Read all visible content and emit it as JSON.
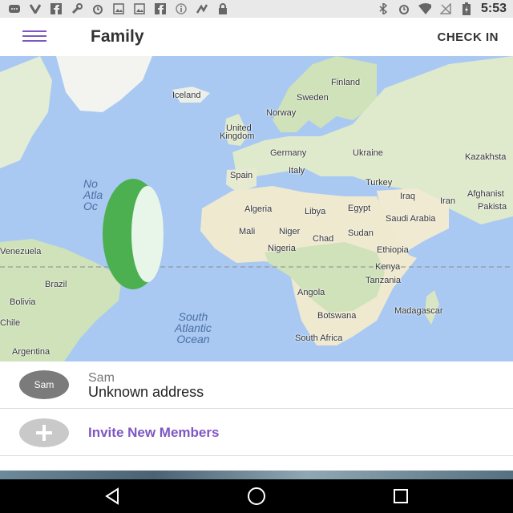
{
  "status_bar": {
    "time": "5:53",
    "left_icons": [
      "message-icon",
      "v-icon",
      "facebook-icon",
      "wrench-icon",
      "alarm-icon",
      "photo-icon",
      "photo-icon",
      "facebook-icon",
      "info-icon",
      "fitness-icon",
      "lock-icon"
    ],
    "right_icons": [
      "bluetooth-icon",
      "alarm-icon",
      "wifi-icon",
      "no-signal-icon",
      "battery-icon"
    ]
  },
  "app_bar": {
    "title": "Family",
    "action_label": "CHECK IN"
  },
  "map": {
    "country_labels": [
      {
        "text": "Finland"
      },
      {
        "text": "Iceland"
      },
      {
        "text": "Sweden"
      },
      {
        "text": "Norway"
      },
      {
        "text": "United"
      },
      {
        "text": "Kingdom"
      },
      {
        "text": "Germany"
      },
      {
        "text": "Ukraine"
      },
      {
        "text": "Kazakhsta"
      },
      {
        "text": "Spain"
      },
      {
        "text": "Italy"
      },
      {
        "text": "Turkey"
      },
      {
        "text": "Iraq"
      },
      {
        "text": "Iran"
      },
      {
        "text": "Afghanist"
      },
      {
        "text": "Pakista"
      },
      {
        "text": "Algeria"
      },
      {
        "text": "Libya"
      },
      {
        "text": "Egypt"
      },
      {
        "text": "Saudi Arabia"
      },
      {
        "text": "Mali"
      },
      {
        "text": "Niger"
      },
      {
        "text": "Chad"
      },
      {
        "text": "Sudan"
      },
      {
        "text": "Nigeria"
      },
      {
        "text": "Ethiopia"
      },
      {
        "text": "Kenya"
      },
      {
        "text": "Tanzania"
      },
      {
        "text": "Angola"
      },
      {
        "text": "Madagascar"
      },
      {
        "text": "Botswana"
      },
      {
        "text": "South Africa"
      },
      {
        "text": "Venezuela"
      },
      {
        "text": "Brazil"
      },
      {
        "text": "Bolivia"
      },
      {
        "text": "Chile"
      },
      {
        "text": "Argentina"
      }
    ],
    "ocean_labels": [
      {
        "text": "No\nAtla\nOc"
      },
      {
        "text": "South\nAtlantic\nOcean"
      }
    ],
    "marker_color": "#4caf50"
  },
  "members": [
    {
      "avatar_text": "Sam",
      "name": "Sam",
      "address": "Unknown address"
    }
  ],
  "invite": {
    "label": "Invite New Members"
  },
  "colors": {
    "accent": "#7e57c2",
    "map_water": "#a9c9f2",
    "land": "#e6efd8"
  }
}
